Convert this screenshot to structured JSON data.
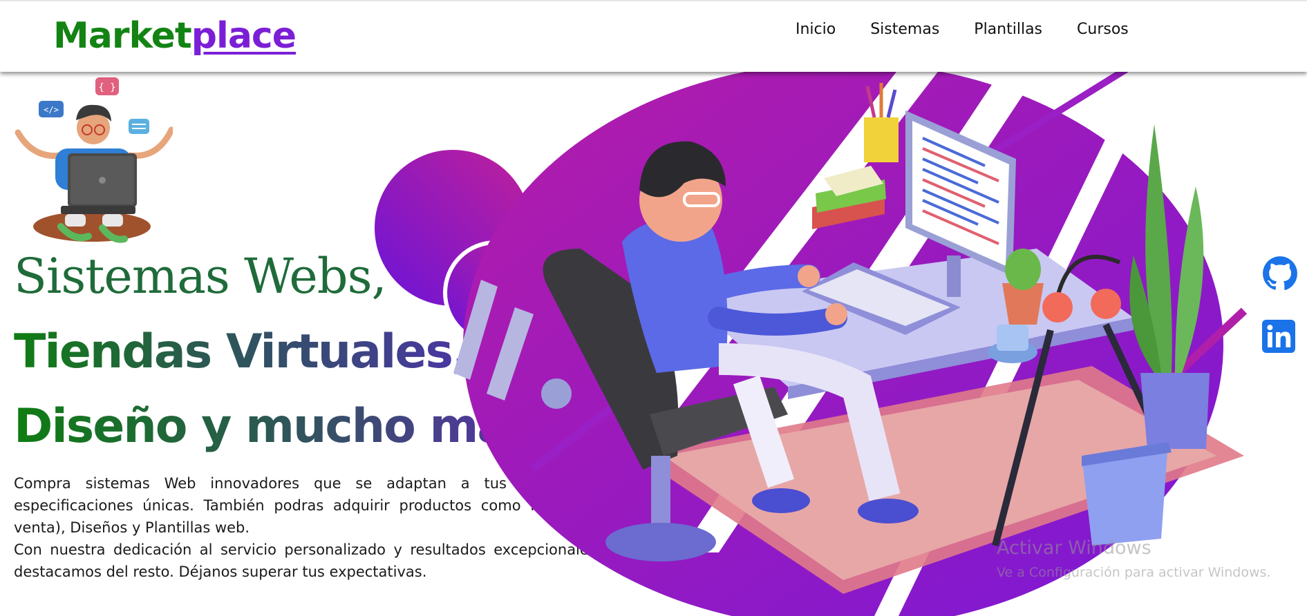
{
  "brand": {
    "part1": "Market",
    "part2": "place"
  },
  "nav": {
    "items": [
      "Inicio",
      "Sistemas",
      "Plantillas",
      "Cursos"
    ]
  },
  "hero": {
    "line1": "Sistemas Webs,",
    "line2": "Tiendas Virtuales,",
    "line3": "Diseño y mucho más.",
    "paragraph1": "Compra sistemas Web innovadores que se adaptan a tus necesidades y especificaciones únicas. También podras adquirir productos como POS(Punto de venta), Diseños y Plantillas web.",
    "paragraph2": "Con nuestra dedicación al servicio personalizado y resultados excepcionales, nos destacamos del resto. Déjanos superar tus expectativas."
  },
  "social": {
    "icons": [
      "github-icon",
      "linkedin-icon"
    ]
  },
  "watermark": {
    "title": "Activar Windows",
    "subtitle": "Ve a Configuración para activar Windows."
  },
  "colors": {
    "brand_green": "#138313",
    "brand_purple": "#7b1fd6",
    "illustration_purple": "#9a1fc4",
    "social_blue": "#1a73e8"
  }
}
